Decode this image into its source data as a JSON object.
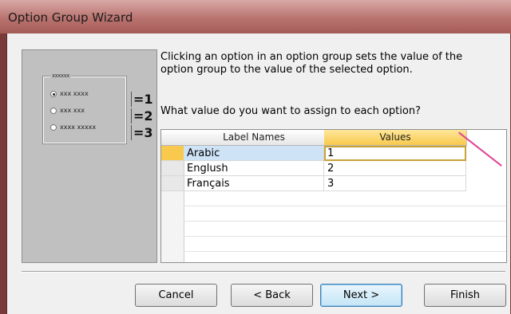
{
  "window": {
    "title": "Option Group Wizard"
  },
  "preview": {
    "legend": "xxxxxx",
    "options": [
      {
        "label": "xxx xxxx",
        "value": "=1",
        "selected": true
      },
      {
        "label": "xxx xxx",
        "value": "=2",
        "selected": false
      },
      {
        "label": "xxxx xxxxx",
        "value": "=3",
        "selected": false
      }
    ]
  },
  "description": "Clicking an option in an option group sets the value of the option group to the value of the selected option.",
  "question": "What value do you want to assign to each option?",
  "grid": {
    "columns": [
      "Label Names",
      "Values"
    ],
    "rows": [
      {
        "label": "Arabic",
        "value": "1"
      },
      {
        "label": "Englush",
        "value": "2"
      },
      {
        "label": "Français",
        "value": "3"
      }
    ]
  },
  "buttons": {
    "cancel": "Cancel",
    "back": "< Back",
    "next": "Next >",
    "finish": "Finish"
  },
  "colors": {
    "accent": "#f8c94d",
    "annotation_arrow": "#e04394"
  }
}
